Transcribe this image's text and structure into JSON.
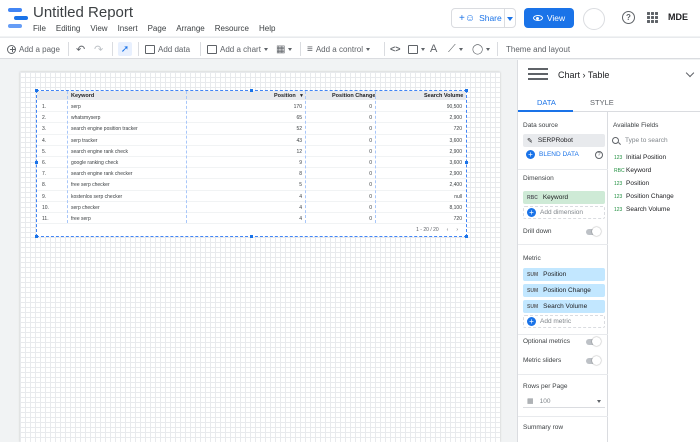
{
  "app": {
    "title": "Untitled Report",
    "menu": [
      "File",
      "Editing",
      "View",
      "Insert",
      "Page",
      "Arrange",
      "Resource",
      "Help"
    ],
    "share_label": "Share",
    "view_label": "View",
    "user_initials": "MDE"
  },
  "toolbar": {
    "add_page": "Add a page",
    "add_data": "Add data",
    "add_chart": "Add a chart",
    "add_control": "Add a control",
    "theme": "Theme and layout"
  },
  "table": {
    "headers": [
      "Keyword",
      "Position",
      "Position Change",
      "Search Volume"
    ],
    "rows": [
      {
        "n": "1.",
        "keyword": "serp",
        "position": "170",
        "change": "0",
        "volume": "90,500"
      },
      {
        "n": "2.",
        "keyword": "whatsmyserp",
        "position": "65",
        "change": "0",
        "volume": "2,900"
      },
      {
        "n": "3.",
        "keyword": "search engine position tracker",
        "position": "52",
        "change": "0",
        "volume": "720"
      },
      {
        "n": "4.",
        "keyword": "serp tracker",
        "position": "43",
        "change": "0",
        "volume": "3,600"
      },
      {
        "n": "5.",
        "keyword": "search engine rank check",
        "position": "12",
        "change": "0",
        "volume": "2,900"
      },
      {
        "n": "6.",
        "keyword": "google ranking check",
        "position": "9",
        "change": "0",
        "volume": "3,600"
      },
      {
        "n": "7.",
        "keyword": "search engine rank checker",
        "position": "8",
        "change": "0",
        "volume": "2,900"
      },
      {
        "n": "8.",
        "keyword": "free serp checker",
        "position": "5",
        "change": "0",
        "volume": "2,400"
      },
      {
        "n": "9.",
        "keyword": "kostenlos serp checker",
        "position": "4",
        "change": "0",
        "volume": "null"
      },
      {
        "n": "10.",
        "keyword": "serp checker",
        "position": "4",
        "change": "0",
        "volume": "8,100"
      },
      {
        "n": "11.",
        "keyword": "free serp",
        "position": "4",
        "change": "0",
        "volume": "720"
      }
    ],
    "pagination": "1 - 20 / 20"
  },
  "panel": {
    "chart_label": "Chart",
    "chart_type": "Table",
    "tab_data": "DATA",
    "tab_style": "STYLE",
    "data_source_label": "Data source",
    "data_source": "SERPRobot",
    "blend_data": "BLEND DATA",
    "dimension_label": "Dimension",
    "dimension": "Keyword",
    "dimension_tag": "RBC",
    "add_dimension": "Add dimension",
    "drill_down": "Drill down",
    "metric_label": "Metric",
    "metrics": [
      {
        "tag": "SUM",
        "name": "Position"
      },
      {
        "tag": "SUM",
        "name": "Position Change"
      },
      {
        "tag": "SUM",
        "name": "Search Volume"
      }
    ],
    "add_metric": "Add metric",
    "optional_metrics": "Optional metrics",
    "metric_sliders": "Metric sliders",
    "rows_per_page_label": "Rows per Page",
    "rows_per_page": "100",
    "summary_row": "Summary row",
    "available_fields_label": "Available Fields",
    "search_placeholder": "Type to search",
    "fields": [
      {
        "type": "123",
        "name": "Initial Position"
      },
      {
        "type": "RBC",
        "name": "Keyword"
      },
      {
        "type": "123",
        "name": "Position"
      },
      {
        "type": "123",
        "name": "Position Change"
      },
      {
        "type": "123",
        "name": "Search Volume"
      }
    ]
  },
  "colors": {
    "accent": "#1a73e8",
    "dimension_chip": "#ceead6",
    "metric_chip": "#c2e7ff"
  }
}
